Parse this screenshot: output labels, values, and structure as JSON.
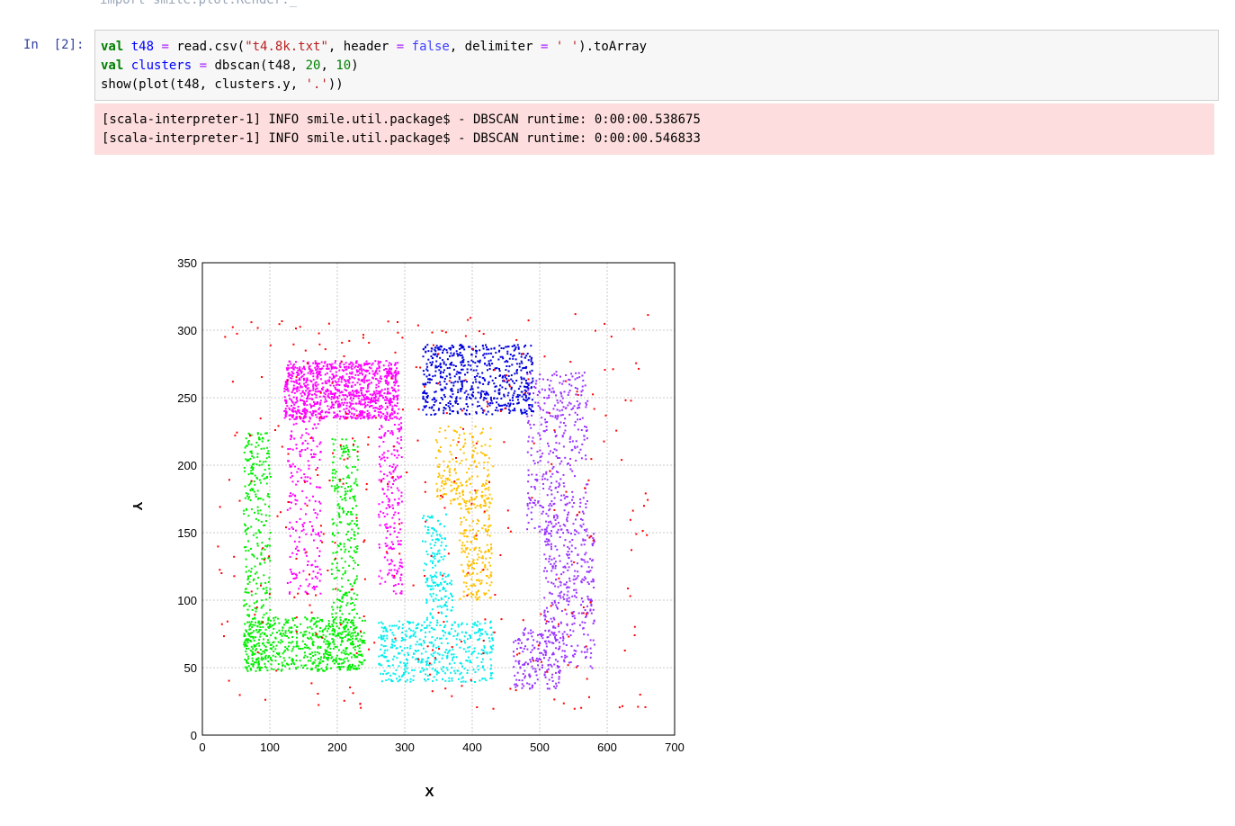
{
  "previous_cell": {
    "text": "import smile.plot.Render._"
  },
  "cell": {
    "prompt": "In  [2]:",
    "code_lines": [
      [
        {
          "t": "val",
          "c": "kw"
        },
        {
          "t": " "
        },
        {
          "t": "t48",
          "c": "var"
        },
        {
          "t": " "
        },
        {
          "t": "=",
          "c": "op"
        },
        {
          "t": " read.csv("
        },
        {
          "t": "\"t4.8k.txt\"",
          "c": "str"
        },
        {
          "t": ", header "
        },
        {
          "t": "=",
          "c": "op"
        },
        {
          "t": " "
        },
        {
          "t": "false",
          "c": "bool"
        },
        {
          "t": ", delimiter "
        },
        {
          "t": "=",
          "c": "op"
        },
        {
          "t": " "
        },
        {
          "t": "' '",
          "c": "str"
        },
        {
          "t": ").toArray"
        }
      ],
      [
        {
          "t": "val",
          "c": "kw"
        },
        {
          "t": " "
        },
        {
          "t": "clusters",
          "c": "var"
        },
        {
          "t": " "
        },
        {
          "t": "=",
          "c": "op"
        },
        {
          "t": " dbscan(t48, "
        },
        {
          "t": "20",
          "c": "num"
        },
        {
          "t": ", "
        },
        {
          "t": "10",
          "c": "num"
        },
        {
          "t": ")"
        }
      ],
      [
        {
          "t": "show(plot(t48, clusters.y, "
        },
        {
          "t": "'.'",
          "c": "str"
        },
        {
          "t": "))"
        }
      ]
    ],
    "stderr_lines": [
      "[scala-interpreter-1] INFO smile.util.package$ - DBSCAN runtime: 0:00:00.538675",
      "[scala-interpreter-1] INFO smile.util.package$ - DBSCAN runtime: 0:00:00.546833"
    ]
  },
  "chart_data": {
    "type": "scatter",
    "title": "",
    "xlabel": "X",
    "ylabel": "Y",
    "xlim": [
      0,
      700
    ],
    "ylim": [
      0,
      350
    ],
    "xticks": [
      "0",
      "100",
      "200",
      "300",
      "400",
      "500",
      "600",
      "700"
    ],
    "yticks": [
      "0",
      "50",
      "100",
      "150",
      "200",
      "250",
      "300",
      "350"
    ],
    "grid": true,
    "legend": "none",
    "clusters": [
      {
        "color": "#ff00ff",
        "regions": [
          [
            120,
            290,
            235,
            278,
            1000
          ],
          [
            125,
            175,
            105,
            240,
            220
          ],
          [
            260,
            295,
            105,
            240,
            210
          ]
        ]
      },
      {
        "color": "#00ee00",
        "regions": [
          [
            60,
            100,
            48,
            225,
            320
          ],
          [
            60,
            240,
            48,
            88,
            520
          ],
          [
            190,
            230,
            90,
            220,
            240
          ],
          [
            160,
            230,
            48,
            88,
            120
          ]
        ]
      },
      {
        "color": "#0000dd",
        "regions": [
          [
            325,
            490,
            238,
            290,
            620
          ]
        ]
      },
      {
        "color": "#ffc000",
        "regions": [
          [
            345,
            430,
            170,
            230,
            180
          ],
          [
            380,
            428,
            100,
            190,
            220
          ]
        ]
      },
      {
        "color": "#00eeee",
        "regions": [
          [
            325,
            360,
            110,
            165,
            90
          ],
          [
            330,
            370,
            85,
            120,
            80
          ],
          [
            260,
            430,
            40,
            85,
            460
          ]
        ]
      },
      {
        "color": "#9933ff",
        "regions": [
          [
            480,
            570,
            150,
            270,
            380
          ],
          [
            505,
            580,
            50,
            160,
            330
          ],
          [
            460,
            530,
            35,
            80,
            170
          ]
        ]
      },
      {
        "color": "#ff0000",
        "regions": [
          [
            20,
            660,
            20,
            315,
            330
          ]
        ]
      }
    ]
  }
}
